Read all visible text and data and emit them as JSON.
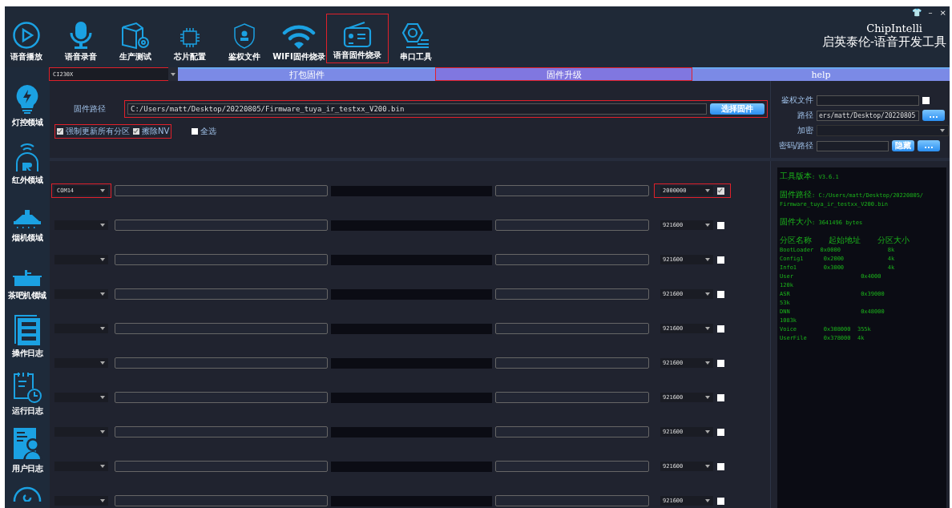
{
  "window": {
    "controls": [
      "👕",
      "–",
      "×"
    ],
    "brand": "ChipIntelli",
    "title": "启英泰伦-语音开发工具"
  },
  "toolbar": [
    {
      "label": "语音播放",
      "highlighted": false
    },
    {
      "label": "语音录音",
      "highlighted": false
    },
    {
      "label": "生产测试",
      "highlighted": false
    },
    {
      "label": "芯片配置",
      "highlighted": false
    },
    {
      "label": "鉴权文件",
      "highlighted": false
    },
    {
      "label": "WIFI固件烧录",
      "highlighted": false
    },
    {
      "label": "语音固件烧录",
      "highlighted": true
    },
    {
      "label": "串口工具",
      "highlighted": false
    }
  ],
  "sidebar": {
    "items": [
      {
        "label": "灯控领域"
      },
      {
        "label": "红外领域"
      },
      {
        "label": "烟机领域"
      },
      {
        "label": "茶吧机领域"
      },
      {
        "label": "操作日志"
      },
      {
        "label": "运行日志"
      },
      {
        "label": "用户日志"
      }
    ]
  },
  "chip_select": {
    "value": "CI230X",
    "highlighted": true
  },
  "tabs": [
    {
      "label": "打包固件",
      "selected": false,
      "highlighted": false
    },
    {
      "label": "固件升级",
      "selected": true,
      "highlighted": true
    },
    {
      "label": "help",
      "selected": false,
      "highlighted": false
    }
  ],
  "firmware": {
    "label": "固件路径",
    "path": "C:/Users/matt/Desktop/20220805/Firmware_tuya_ir_testxx_V200.bin",
    "button": "选择固件",
    "highlighted": true
  },
  "options": [
    {
      "label": "强制更新所有分区",
      "checked": true,
      "highlighted": true
    },
    {
      "label": "擦除NV",
      "checked": true,
      "highlighted": true
    },
    {
      "label": "全选",
      "checked": false,
      "highlighted": false
    }
  ],
  "auth": {
    "file_label": "鉴权文件",
    "file_checked": false,
    "path_label": "路径",
    "path_value": "ers/matt/Desktop/20220805",
    "path_button": "...",
    "encrypt_label": "加密",
    "password_label": "密码/路径",
    "hide_button": "隐藏",
    "password_button": "..."
  },
  "ports": [
    {
      "port": "COM14",
      "baud": "2000000",
      "checked": true,
      "highlighted": true,
      "level": 0
    },
    {
      "baud": "921600",
      "checked": false,
      "highlighted": false,
      "level": 0
    },
    {
      "baud": "921600",
      "checked": false,
      "highlighted": false,
      "level": 0
    },
    {
      "baud": "921600",
      "checked": false,
      "highlighted": false,
      "level": 0
    },
    {
      "baud": "921600",
      "checked": false,
      "highlighted": false,
      "level": 0
    },
    {
      "baud": "921600",
      "checked": false,
      "highlighted": false,
      "level": 0
    },
    {
      "baud": "921600",
      "checked": false,
      "highlighted": false,
      "level": 0
    },
    {
      "baud": "921600",
      "checked": false,
      "highlighted": false,
      "level": 0
    },
    {
      "baud": "921600",
      "checked": false,
      "highlighted": false,
      "level": 0
    },
    {
      "baud": "921600",
      "checked": false,
      "highlighted": false,
      "level": 0
    }
  ],
  "log": [
    [
      "工具版本: V3.6.1"
    ],
    [
      "固件路径: C:/Users/matt/Desktop/20220805/",
      "Firmware_tuya_ir_testxx_V200.bin"
    ],
    [
      "固件大小: 3641496 bytes"
    ],
    [
      "分区名称     起始地址     分区大小",
      "BootLoader  0x0000              8k",
      "Config1      0x2000             4k",
      "Info1        0x3000             4k",
      "User                    0x4000",
      "120k",
      "ASR                     0x39000",
      "53k",
      "DNN                     0x48000",
      "1083k",
      "Voice        0x308000  355k",
      "UserFile     0x378000  4k"
    ]
  ]
}
